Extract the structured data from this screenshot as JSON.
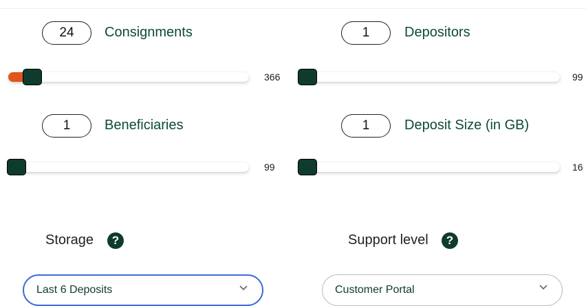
{
  "consignments": {
    "value": "24",
    "label": "Consignments",
    "max_label": "366",
    "fraction": 0.062
  },
  "depositors": {
    "value": "1",
    "label": "Depositors",
    "max_label": "99",
    "fraction": 0.0
  },
  "beneficiaries": {
    "value": "1",
    "label": "Beneficiaries",
    "max_label": "99",
    "fraction": 0.0
  },
  "deposit_size": {
    "value": "1",
    "label": "Deposit Size (in GB)",
    "max_label": "16",
    "fraction": 0.0
  },
  "storage": {
    "title": "Storage",
    "help_icon": "?",
    "selected": "Last 6 Deposits"
  },
  "support": {
    "title": "Support level",
    "help_icon": "?",
    "selected": "Customer Portal"
  },
  "colors": {
    "accent": "#e2541e",
    "thumb": "#0f3b2f",
    "label": "#0c4a3a",
    "focus": "#3d6cd6"
  }
}
